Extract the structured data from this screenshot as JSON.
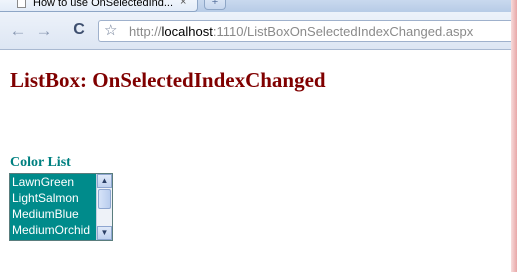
{
  "browser": {
    "tab_title": "How to use OnSelectedInd...",
    "tab_close": "×",
    "new_tab_label": "+",
    "back_glyph": "←",
    "forward_glyph": "→",
    "reload_glyph": "C",
    "star_glyph": "☆",
    "url_scheme": "http://",
    "url_host": "localhost",
    "url_rest": ":1110/ListBoxOnSelectedIndexChanged.aspx"
  },
  "page": {
    "title": "ListBox: OnSelectedIndexChanged",
    "list_label": "Color List",
    "listbox": {
      "options": [
        "LawnGreen",
        "LightSalmon",
        "MediumBlue",
        "MediumOrchid"
      ],
      "background": "#008b8b",
      "text_color": "#ffffff"
    }
  },
  "colors": {
    "title": "#800000",
    "label": "#008080"
  }
}
